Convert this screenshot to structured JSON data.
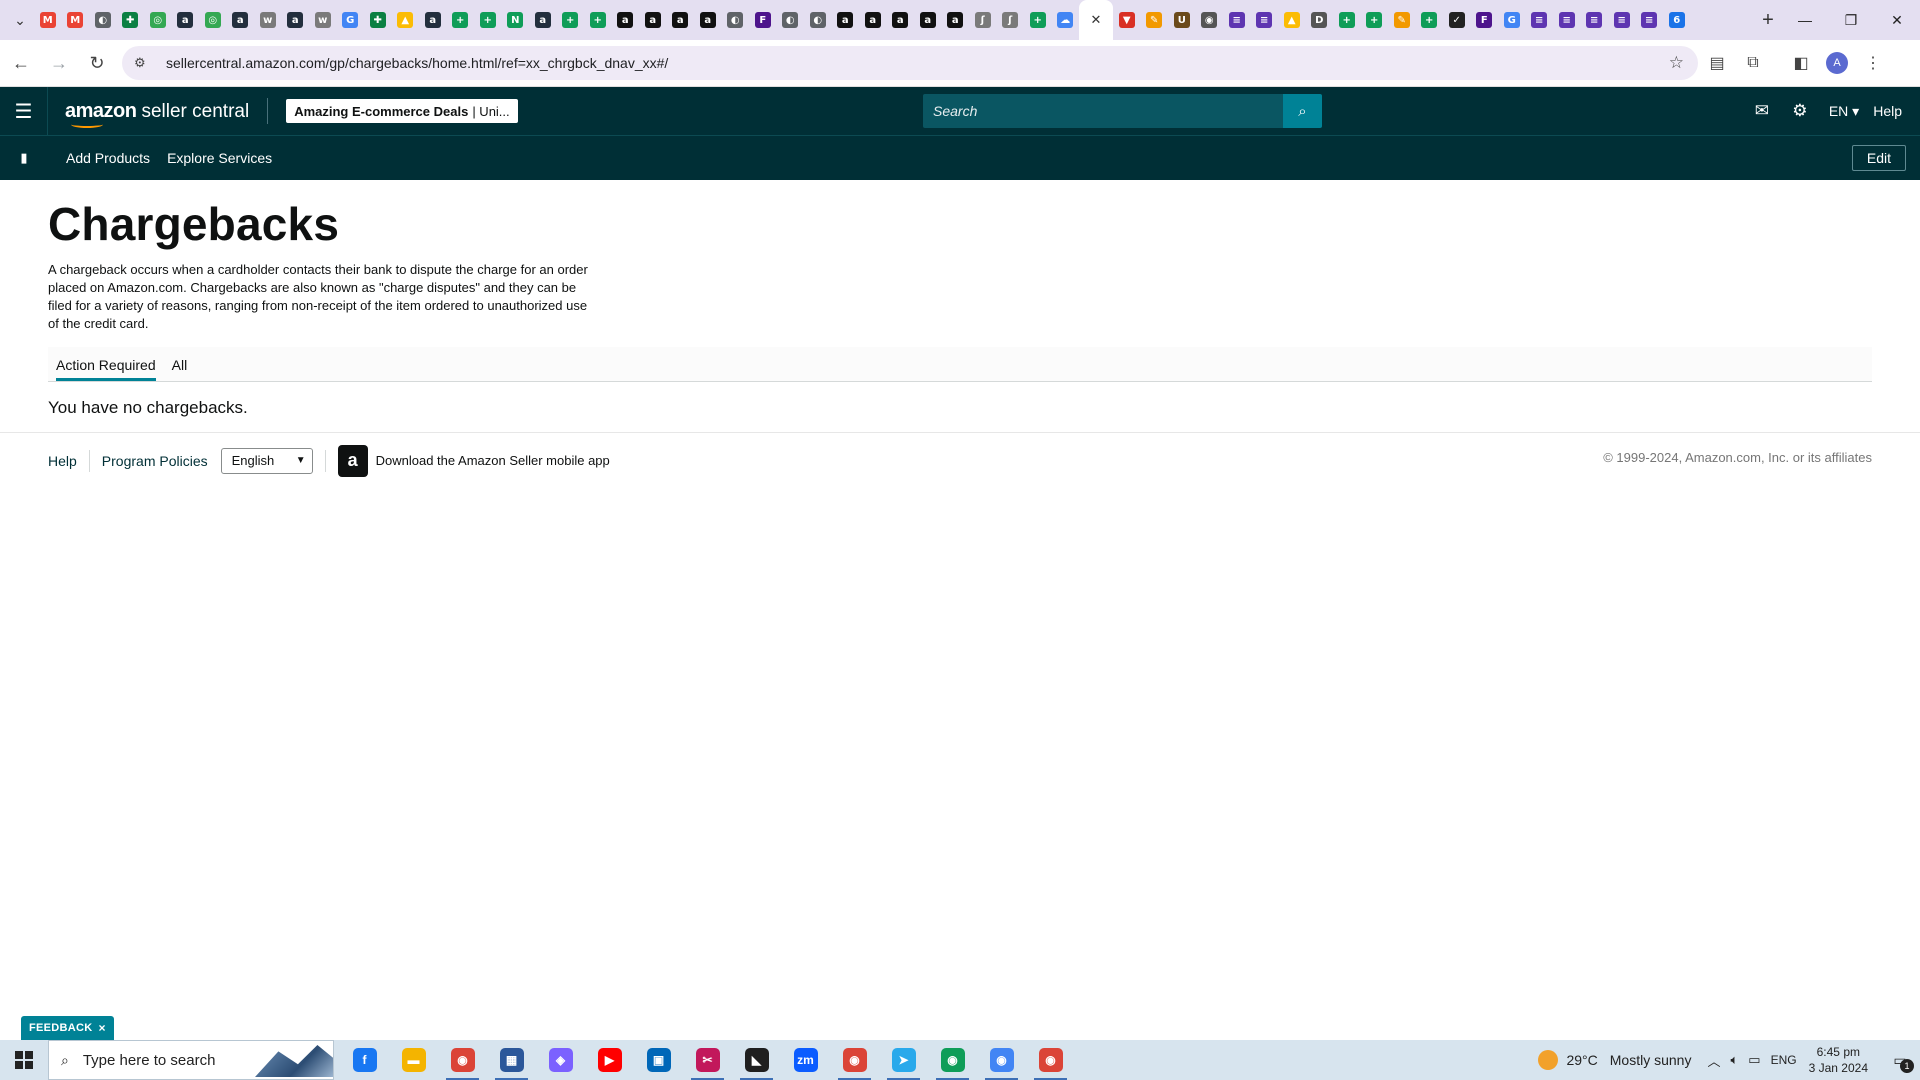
{
  "browser": {
    "tab_menu_icon": "chevron-down-icon",
    "tab_favicons": [
      {
        "icon": "gmail",
        "color": "#ea4335",
        "glyph": "M"
      },
      {
        "icon": "gmail",
        "color": "#ea4335",
        "glyph": "M"
      },
      {
        "icon": "globe",
        "color": "#5f6368",
        "glyph": "◐"
      },
      {
        "icon": "puzzle",
        "color": "#0b8043",
        "glyph": "✚"
      },
      {
        "icon": "green-circle",
        "color": "#34a853",
        "glyph": "◎"
      },
      {
        "icon": "amazon",
        "color": "#232f3e",
        "glyph": "a"
      },
      {
        "icon": "green-circle",
        "color": "#34a853",
        "glyph": "◎"
      },
      {
        "icon": "amazon",
        "color": "#232f3e",
        "glyph": "a"
      },
      {
        "icon": "wix",
        "color": "#7a7a7a",
        "glyph": "w"
      },
      {
        "icon": "amazon",
        "color": "#232f3e",
        "glyph": "a"
      },
      {
        "icon": "wix",
        "color": "#7a7a7a",
        "glyph": "w"
      },
      {
        "icon": "google",
        "color": "#4285f4",
        "glyph": "G"
      },
      {
        "icon": "puzzle",
        "color": "#0b8043",
        "glyph": "✚"
      },
      {
        "icon": "drive",
        "color": "#fbbc04",
        "glyph": "▲"
      },
      {
        "icon": "amazon",
        "color": "#232f3e",
        "glyph": "a"
      },
      {
        "icon": "plus-sheet",
        "color": "#0f9d58",
        "glyph": "+"
      },
      {
        "icon": "plus-sheet",
        "color": "#0f9d58",
        "glyph": "+"
      },
      {
        "icon": "n-logo",
        "color": "#0f9d58",
        "glyph": "N"
      },
      {
        "icon": "amazon",
        "color": "#232f3e",
        "glyph": "a"
      },
      {
        "icon": "plus-sheet",
        "color": "#0f9d58",
        "glyph": "+"
      },
      {
        "icon": "plus-sheet",
        "color": "#0f9d58",
        "glyph": "+"
      },
      {
        "icon": "amazon-box",
        "color": "#111111",
        "glyph": "a"
      },
      {
        "icon": "amazon-box",
        "color": "#111111",
        "glyph": "a"
      },
      {
        "icon": "amazon-box",
        "color": "#111111",
        "glyph": "a"
      },
      {
        "icon": "amazon-box",
        "color": "#111111",
        "glyph": "a"
      },
      {
        "icon": "globe",
        "color": "#5f6368",
        "glyph": "◐"
      },
      {
        "icon": "fedex",
        "color": "#4d148c",
        "glyph": "F"
      },
      {
        "icon": "globe",
        "color": "#5f6368",
        "glyph": "◐"
      },
      {
        "icon": "globe",
        "color": "#5f6368",
        "glyph": "◐"
      },
      {
        "icon": "amazon-box",
        "color": "#111111",
        "glyph": "a"
      },
      {
        "icon": "amazon-box",
        "color": "#111111",
        "glyph": "a"
      },
      {
        "icon": "amazon-box",
        "color": "#111111",
        "glyph": "a"
      },
      {
        "icon": "amazon-box",
        "color": "#111111",
        "glyph": "a"
      },
      {
        "icon": "amazon-box",
        "color": "#111111",
        "glyph": "a"
      },
      {
        "icon": "script",
        "color": "#7a7a7a",
        "glyph": "ʃ"
      },
      {
        "icon": "script",
        "color": "#7a7a7a",
        "glyph": "ʃ"
      },
      {
        "icon": "plus-sheet",
        "color": "#0f9d58",
        "glyph": "+"
      },
      {
        "icon": "cloud",
        "color": "#4285f4",
        "glyph": "☁"
      }
    ],
    "active_tab_icon": "close-icon",
    "tab_favicons_right": [
      {
        "icon": "red-v",
        "color": "#d93025",
        "glyph": "▼"
      },
      {
        "icon": "pen",
        "color": "#f29900",
        "glyph": "✎"
      },
      {
        "icon": "ups",
        "color": "#6b4a1b",
        "glyph": "U"
      },
      {
        "icon": "usps",
        "color": "#555555",
        "glyph": "◉"
      },
      {
        "icon": "list-doc",
        "color": "#5e35b1",
        "glyph": "≡"
      },
      {
        "icon": "list-doc",
        "color": "#5e35b1",
        "glyph": "≡"
      },
      {
        "icon": "drive",
        "color": "#fbbc04",
        "glyph": "▲"
      },
      {
        "icon": "dhl",
        "color": "#555555",
        "glyph": "D"
      },
      {
        "icon": "plus-sheet",
        "color": "#0f9d58",
        "glyph": "+"
      },
      {
        "icon": "plus-sheet",
        "color": "#0f9d58",
        "glyph": "+"
      },
      {
        "icon": "pen",
        "color": "#f29900",
        "glyph": "✎"
      },
      {
        "icon": "plus-sheet",
        "color": "#0f9d58",
        "glyph": "+"
      },
      {
        "icon": "check-logo",
        "color": "#222222",
        "glyph": "✓"
      },
      {
        "icon": "fedex",
        "color": "#4d148c",
        "glyph": "F"
      },
      {
        "icon": "google",
        "color": "#4285f4",
        "glyph": "G"
      },
      {
        "icon": "list-doc",
        "color": "#5e35b1",
        "glyph": "≡"
      },
      {
        "icon": "list-doc",
        "color": "#5e35b1",
        "glyph": "≡"
      },
      {
        "icon": "list-doc",
        "color": "#5e35b1",
        "glyph": "≡"
      },
      {
        "icon": "list-doc",
        "color": "#5e35b1",
        "glyph": "≡"
      },
      {
        "icon": "list-doc",
        "color": "#5e35b1",
        "glyph": "≡"
      },
      {
        "icon": "leaf",
        "color": "#1a73e8",
        "glyph": "6"
      }
    ],
    "url": "sellercentral.amazon.com/gp/chargebacks/home.html/ref=xx_chrgbck_dnav_xx#/",
    "profile_initial": "A"
  },
  "header": {
    "logo_amazon": "amazon",
    "logo_sc": "seller central",
    "store_name": "Amazing E-commerce Deals",
    "store_market": "| Uni...",
    "search_placeholder": "Search",
    "lang": "EN ▾",
    "help": "Help"
  },
  "subnav": {
    "links": [
      "Add Products",
      "Explore Services"
    ],
    "edit": "Edit"
  },
  "main": {
    "title": "Chargebacks",
    "description": "A chargeback occurs when a cardholder contacts their bank to dispute the charge for an order placed on Amazon.com. Chargebacks are also known as \"charge disputes\" and they can be filed for a variety of reasons, ranging from non-receipt of the item ordered to unauthorized use of the credit card.",
    "tabs": [
      {
        "label": "Action Required",
        "active": true
      },
      {
        "label": "All",
        "active": false
      }
    ],
    "empty_message": "You have no chargebacks."
  },
  "footer": {
    "help": "Help",
    "policies": "Program Policies",
    "language": "English",
    "app_badge_glyph": "a",
    "app_link": "Download the Amazon Seller mobile app",
    "copyright": "© 1999-2024, Amazon.com, Inc. or its affiliates"
  },
  "feedback": {
    "label": "FEEDBACK",
    "close": "×"
  },
  "taskbar": {
    "search_text": "Type here to search",
    "apps": [
      {
        "name": "facebook",
        "color": "#1877f2",
        "glyph": "f",
        "running": false
      },
      {
        "name": "file-explorer",
        "color": "#f4b400",
        "glyph": "▬",
        "running": false
      },
      {
        "name": "chrome",
        "color": "#db4437",
        "glyph": "◉",
        "running": true
      },
      {
        "name": "calculator",
        "color": "#2b579a",
        "glyph": "▦",
        "running": true
      },
      {
        "name": "copilot",
        "color": "#7b61ff",
        "glyph": "◈",
        "running": false
      },
      {
        "name": "youtube",
        "color": "#ff0000",
        "glyph": "▶",
        "running": false
      },
      {
        "name": "store",
        "color": "#0067b8",
        "glyph": "▣",
        "running": false
      },
      {
        "name": "snipping",
        "color": "#c2185b",
        "glyph": "✂",
        "running": true
      },
      {
        "name": "sticky-notes",
        "color": "#1f1f1f",
        "glyph": "◣",
        "running": true
      },
      {
        "name": "zoom",
        "color": "#0b5cff",
        "glyph": "zm",
        "running": false
      },
      {
        "name": "chrome-profile",
        "color": "#db4437",
        "glyph": "◉",
        "running": true
      },
      {
        "name": "telegram",
        "color": "#29a9eb",
        "glyph": "➤",
        "running": true
      },
      {
        "name": "chrome-profile-a",
        "color": "#0f9d58",
        "glyph": "◉",
        "running": true
      },
      {
        "name": "chrome-profile-b",
        "color": "#4285f4",
        "glyph": "◉",
        "running": true
      },
      {
        "name": "chrome-profile-c",
        "color": "#db4437",
        "glyph": "◉",
        "running": true
      }
    ],
    "weather_temp": "29°C",
    "weather_text": "Mostly sunny",
    "input_lang": "ENG",
    "time": "6:45 pm",
    "date": "3 Jan 2024",
    "notification_count": "1"
  }
}
